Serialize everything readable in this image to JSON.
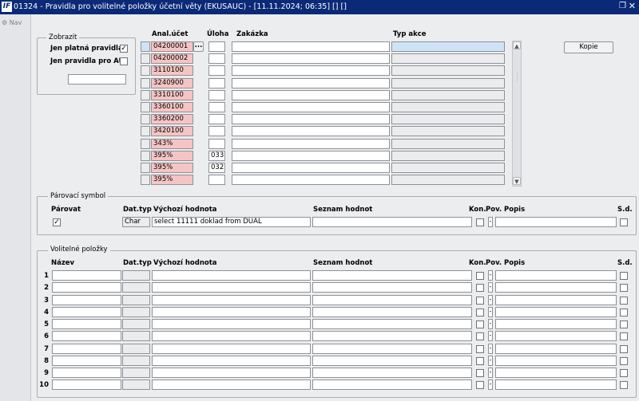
{
  "window": {
    "title": "01324 - Pravidla pro volitelné položky účetní věty (EKUSAUC) - [11.11.2024; 06:35]  [] []",
    "logo": "IF"
  },
  "nav": {
    "label": "Nav"
  },
  "zobrazit": {
    "legend": "Zobrazit",
    "jen_platna_label": "Jen platná pravidla",
    "jen_platna_checked": true,
    "jen_au_label": "Jen pravidla pro AU",
    "jen_au_checked": false,
    "filter_value": ""
  },
  "grid": {
    "headers": {
      "anal": "Anal.účet",
      "uloha": "Úloha",
      "zakazka": "Zakázka",
      "typ_akce": "Typ akce"
    },
    "rows": [
      {
        "anal": "04200001",
        "uloha": "",
        "zakazka": "",
        "typ": ""
      },
      {
        "anal": "04200002",
        "uloha": "",
        "zakazka": "",
        "typ": ""
      },
      {
        "anal": "3110100",
        "uloha": "",
        "zakazka": "",
        "typ": ""
      },
      {
        "anal": "3240900",
        "uloha": "",
        "zakazka": "",
        "typ": ""
      },
      {
        "anal": "3310100",
        "uloha": "",
        "zakazka": "",
        "typ": ""
      },
      {
        "anal": "3360100",
        "uloha": "",
        "zakazka": "",
        "typ": ""
      },
      {
        "anal": "3360200",
        "uloha": "",
        "zakazka": "",
        "typ": ""
      },
      {
        "anal": "3420100",
        "uloha": "",
        "zakazka": "",
        "typ": ""
      },
      {
        "anal": "343%",
        "uloha": "",
        "zakazka": "",
        "typ": ""
      },
      {
        "anal": "395%",
        "uloha": "033",
        "zakazka": "",
        "typ": ""
      },
      {
        "anal": "395%",
        "uloha": "032",
        "zakazka": "",
        "typ": ""
      },
      {
        "anal": "395%",
        "uloha": "",
        "zakazka": "",
        "typ": ""
      }
    ],
    "lov_button": "..."
  },
  "kopie_button": "Kopie",
  "parovaci": {
    "legend": "Párovací symbol",
    "headers": {
      "parovat": "Párovat",
      "dattyp": "Dat.typ",
      "vychozi": "Výchozí hodnota",
      "seznam": "Seznam hodnot",
      "kon": "Kon.",
      "pov": "Pov.",
      "popis": "Popis",
      "sd": "S.d."
    },
    "parovat_checked": true,
    "dattyp": "Char",
    "vychozi": "select 11111 doklad from DUAL",
    "seznam": "",
    "pov": "-",
    "popis": ""
  },
  "volitelne": {
    "legend": "Volitelné položky",
    "headers": {
      "nazev": "Název",
      "dattyp": "Dat.typ",
      "vychozi": "Výchozí hodnota",
      "seznam": "Seznam hodnot",
      "kon": "Kon.",
      "pov": "Pov.",
      "popis": "Popis",
      "sd": "S.d."
    },
    "rows": [
      {
        "num": "1",
        "pov": "-"
      },
      {
        "num": "2",
        "pov": "-"
      },
      {
        "num": "3",
        "pov": "-"
      },
      {
        "num": "4",
        "pov": "-"
      },
      {
        "num": "5",
        "pov": "-"
      },
      {
        "num": "6",
        "pov": "-"
      },
      {
        "num": "7",
        "pov": "-"
      },
      {
        "num": "8",
        "pov": "-"
      },
      {
        "num": "9",
        "pov": "-"
      },
      {
        "num": "10",
        "pov": "-"
      }
    ]
  }
}
